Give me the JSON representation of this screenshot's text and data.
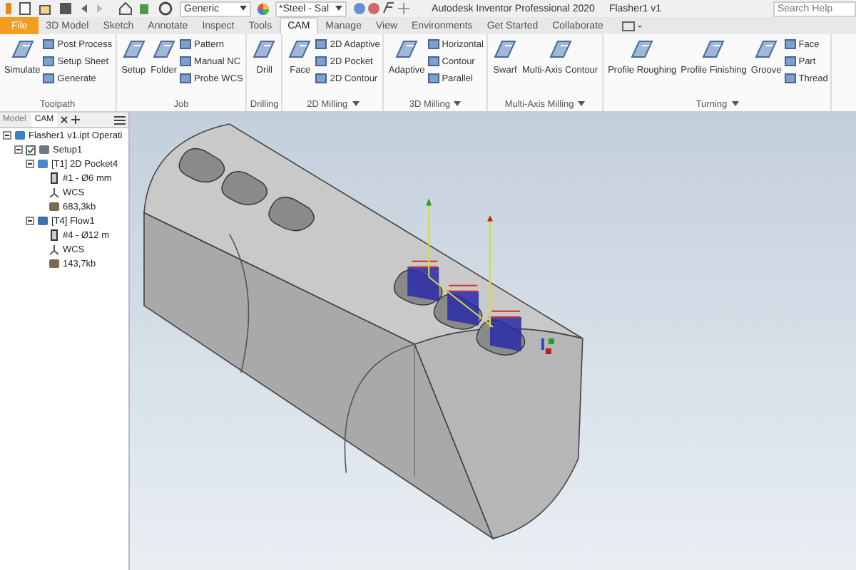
{
  "title_bar": {
    "material": "Generic",
    "appearance": "*Steel - Sal",
    "app_title": "Autodesk Inventor Professional 2020",
    "document_title": "Flasher1 v1",
    "search": {
      "placeholder": "Search Help"
    }
  },
  "tabs": [
    {
      "label": "File",
      "kind": "file",
      "selected": false
    },
    {
      "label": "3D Model",
      "kind": "tab",
      "selected": false
    },
    {
      "label": "Sketch",
      "kind": "tab",
      "selected": false
    },
    {
      "label": "Annotate",
      "kind": "tab",
      "selected": false
    },
    {
      "label": "Inspect",
      "kind": "tab",
      "selected": false
    },
    {
      "label": "Tools",
      "kind": "tab",
      "selected": false
    },
    {
      "label": "CAM",
      "kind": "tab",
      "selected": true
    },
    {
      "label": "Manage",
      "kind": "tab",
      "selected": false
    },
    {
      "label": "View",
      "kind": "tab",
      "selected": false
    },
    {
      "label": "Environments",
      "kind": "tab",
      "selected": false
    },
    {
      "label": "Get Started",
      "kind": "tab",
      "selected": false
    },
    {
      "label": "Collaborate",
      "kind": "tab",
      "selected": false
    }
  ],
  "ribbon": [
    {
      "title": "Toolpath",
      "menu": false,
      "large": [
        "Simulate"
      ],
      "small": [
        "Post Process",
        "Setup Sheet",
        "Generate"
      ]
    },
    {
      "title": "Job",
      "menu": false,
      "large": [
        "Setup",
        "Folder"
      ],
      "small": [
        "Pattern",
        "Manual NC",
        "Probe WCS"
      ]
    },
    {
      "title": "Drilling",
      "menu": false,
      "large": [
        "Drill"
      ]
    },
    {
      "title": "2D Milling",
      "menu": true,
      "large": [
        "Face"
      ],
      "small": [
        "2D Adaptive",
        "2D Pocket",
        "2D Contour"
      ]
    },
    {
      "title": "3D Milling",
      "menu": true,
      "large": [
        "Adaptive"
      ],
      "small": [
        "Horizontal",
        "Contour",
        "Parallel"
      ]
    },
    {
      "title": "Multi-Axis Milling",
      "menu": true,
      "large": [
        "Swarf",
        "Multi-Axis Contour"
      ]
    },
    {
      "title": "Turning",
      "menu": true,
      "large": [
        "Profile Roughing",
        "Profile Finishing",
        "Groove"
      ],
      "small": [
        "Face",
        "Part",
        "Thread"
      ]
    }
  ],
  "browser": {
    "tabs": [
      {
        "label": "Model",
        "selected": false
      },
      {
        "label": "CAM",
        "selected": true
      }
    ],
    "tree": [
      {
        "label": "Flasher1 v1.ipt Operati",
        "kind": "operations",
        "expanded": true,
        "children": [
          {
            "label": "Setup1",
            "kind": "setup",
            "checked": true,
            "expanded": true,
            "children": [
              {
                "label": "[T1] 2D Pocket4",
                "kind": "operation",
                "expanded": true,
                "children": [
                  {
                    "label": "#1 - Ø6 mm",
                    "kind": "tool"
                  },
                  {
                    "label": "WCS",
                    "kind": "wcs"
                  },
                  {
                    "label": "683,3kb",
                    "kind": "file"
                  }
                ]
              },
              {
                "label": "[T4] Flow1",
                "kind": "flow",
                "expanded": true,
                "children": [
                  {
                    "label": "#4 - Ø12 m",
                    "kind": "tool"
                  },
                  {
                    "label": "WCS",
                    "kind": "wcs"
                  },
                  {
                    "label": "143,7kb",
                    "kind": "file"
                  }
                ]
              }
            ]
          }
        ]
      }
    ]
  }
}
